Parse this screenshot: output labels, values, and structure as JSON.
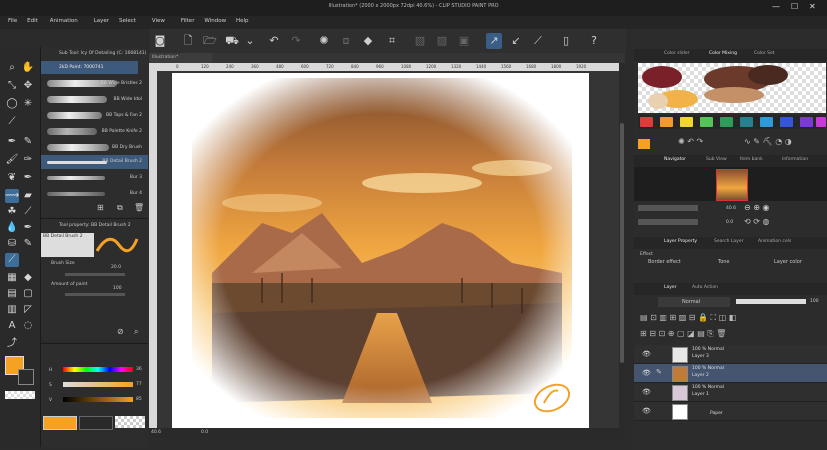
{
  "window": {
    "title": "Illustration* (2000 x 2000px 72dpi 40.6%) - CLIP STUDIO PAINT PRO",
    "min": "—",
    "max": "☐",
    "close": "✕"
  },
  "menu": [
    "File",
    "Edit",
    "Animation",
    "Layer",
    "Select",
    "View",
    "Filter",
    "Window",
    "Help"
  ],
  "subtool": {
    "header": "Sub Tool: Icy Of Detailing (C: 1668141)",
    "selected": "2kD Paint: 7000741",
    "brushes": [
      "BB Wide Bristles 2",
      "BB Wide Idol",
      "BB Taps & Fan 2",
      "BB Palette Knife 2",
      "BB Dry Brush",
      "BB Detail Brush 2",
      "Bur 3",
      "Bur 4"
    ]
  },
  "toolprop": {
    "header": "Tool property: BB Detail Brush 2",
    "name": "BB Detail Brush 2",
    "brush_size_label": "Brush Size",
    "brush_size": "20.0",
    "amount_label": "Amount of paint",
    "amount": "100"
  },
  "colorpanel": {
    "h_label": "H",
    "h": "36",
    "s_label": "S",
    "s": "77",
    "v_label": "V",
    "v": "85",
    "main_color": "#f4a124"
  },
  "canvas": {
    "tab": "Illustration*",
    "ruler": [
      "0",
      "120",
      "240",
      "360",
      "480",
      "600",
      "720",
      "840",
      "960",
      "1080",
      "1200",
      "1320",
      "1440",
      "1560",
      "1680",
      "1800",
      "1920"
    ],
    "zoom": "40.6",
    "angle": "0.0"
  },
  "right": {
    "tabs": [
      "Color slider",
      "Color Mixing",
      "Color Set"
    ],
    "swatches": [
      "#e03a3a",
      "#f39a2c",
      "#f2d531",
      "#56c35a",
      "#2f9c5c",
      "#2a7f8f",
      "#2e9bd8",
      "#3556d6",
      "#7a3ad8",
      "#c73ad8"
    ],
    "nav_tabs": [
      "Navigator",
      "Sub View",
      "Item bank",
      "Information"
    ],
    "nav_zoom": "40.6",
    "nav_angle": "0.0",
    "lp_tabs": [
      "Layer Property",
      "Search Layer",
      "Animation cels"
    ],
    "effect_label": "Effect",
    "effects": [
      "Border effect",
      "Tone",
      "Layer color"
    ],
    "layer_tabs": [
      "Layer",
      "Auto Action"
    ],
    "blend_mode": "Normal",
    "opacity": "100",
    "layers": [
      {
        "pct": "100 % Normal",
        "name": "Layer 3",
        "thumb": "#e8e8e8",
        "sel": false
      },
      {
        "pct": "100 % Normal",
        "name": "Layer 2",
        "thumb": "#c07a3a",
        "sel": true
      },
      {
        "pct": "100 % Normal",
        "name": "Layer 1",
        "thumb": "#d8c8d8",
        "sel": false
      },
      {
        "pct": "",
        "name": "Paper",
        "thumb": "#ffffff",
        "sel": false
      }
    ]
  }
}
